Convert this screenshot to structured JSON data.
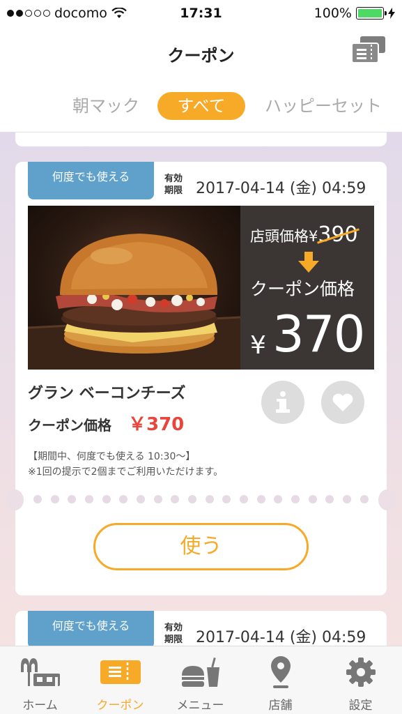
{
  "status_bar": {
    "carrier": "docomo",
    "time": "17:31",
    "battery": "100%",
    "battery_level": 1.0
  },
  "header": {
    "title": "クーポン",
    "ticket_icon": "ticket-stack-icon"
  },
  "tabs": [
    {
      "label": "朝マック",
      "active": false
    },
    {
      "label": "すべて",
      "active": true
    },
    {
      "label": "ハッピーセット",
      "active": false
    }
  ],
  "coupon": {
    "badge": "何度でも使える",
    "expiry_label_line1": "有効",
    "expiry_label_line2": "期限",
    "expiry_date": "2017-04-14 (金) 04:59",
    "store_price_label": "店頭価格¥",
    "store_price": "390",
    "coupon_price_label": "クーポン価格",
    "coupon_price_yen": "¥",
    "coupon_price_big": "370",
    "item_name": "グラン ベーコンチーズ",
    "price_label": "クーポン価格",
    "price_value": "￥370",
    "note_line1": "【期間中、何度でも使える 10:30～】",
    "note_line2": "※1回の提示で2個までご利用いただけます。",
    "use_button": "使う"
  },
  "next_coupon": {
    "badge": "何度でも使える",
    "expiry_label_line1": "有効",
    "expiry_label_line2": "期限",
    "expiry_date": "2017-04-14 (金) 04:59"
  },
  "bottom_nav": [
    {
      "label": "ホーム",
      "icon": "home-icon",
      "active": false
    },
    {
      "label": "クーポン",
      "icon": "coupon-icon",
      "active": true
    },
    {
      "label": "メニュー",
      "icon": "menu-icon",
      "active": false
    },
    {
      "label": "店舗",
      "icon": "store-pin-icon",
      "active": false
    },
    {
      "label": "設定",
      "icon": "settings-gear-icon",
      "active": false
    }
  ],
  "colors": {
    "accent": "#f7a928",
    "badge": "#5fa1cb",
    "price_red": "#e8453c"
  }
}
